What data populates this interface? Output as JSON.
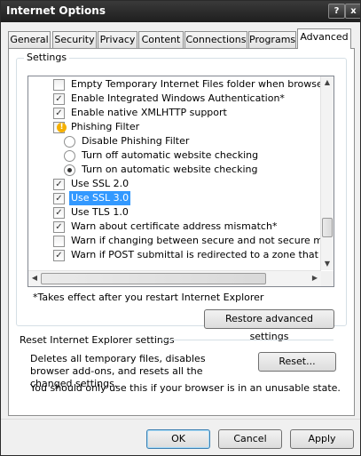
{
  "window": {
    "title": "Internet Options",
    "help_glyph": "?",
    "close_glyph": "x"
  },
  "tabs": [
    {
      "label": "General"
    },
    {
      "label": "Security"
    },
    {
      "label": "Privacy"
    },
    {
      "label": "Content"
    },
    {
      "label": "Connections"
    },
    {
      "label": "Programs"
    },
    {
      "label": "Advanced"
    }
  ],
  "active_tab": "Advanced",
  "settings": {
    "group_label": "Settings",
    "items": [
      {
        "type": "checkbox",
        "checked": false,
        "label": "Empty Temporary Internet Files folder when browser is cl"
      },
      {
        "type": "checkbox",
        "checked": true,
        "label": "Enable Integrated Windows Authentication*"
      },
      {
        "type": "checkbox",
        "checked": true,
        "label": "Enable native XMLHTTP support"
      },
      {
        "type": "category",
        "icon": "warning-shield-icon",
        "label": "Phishing Filter"
      },
      {
        "type": "radio",
        "selected": false,
        "label": "Disable Phishing Filter"
      },
      {
        "type": "radio",
        "selected": false,
        "label": "Turn off automatic website checking"
      },
      {
        "type": "radio",
        "selected": true,
        "label": "Turn on automatic website checking"
      },
      {
        "type": "checkbox",
        "checked": true,
        "label": "Use SSL 2.0"
      },
      {
        "type": "checkbox",
        "checked": true,
        "label": "Use SSL 3.0",
        "highlighted": true
      },
      {
        "type": "checkbox",
        "checked": true,
        "label": "Use TLS 1.0"
      },
      {
        "type": "checkbox",
        "checked": true,
        "label": "Warn about certificate address mismatch*"
      },
      {
        "type": "checkbox",
        "checked": false,
        "label": "Warn if changing between secure and not secure mode"
      },
      {
        "type": "checkbox",
        "checked": true,
        "label": "Warn if POST submittal is redirected to a zone that does n"
      }
    ],
    "vertical_scroll_fraction": 0.85,
    "horizontal_scroll_fraction": 0.0
  },
  "note": "*Takes effect after you restart Internet Explorer",
  "restore_button": "Restore advanced settings",
  "reset": {
    "title": "Reset Internet Explorer settings",
    "description": "Deletes all temporary files, disables browser add-ons, and resets all the changed settings.",
    "button": "Reset...",
    "warning": "You should only use this if your browser is in an unusable state."
  },
  "footer": {
    "ok": "OK",
    "cancel": "Cancel",
    "apply": "Apply"
  },
  "colors": {
    "selection": "#3399ff",
    "titlebar": "#1e1e1e"
  }
}
